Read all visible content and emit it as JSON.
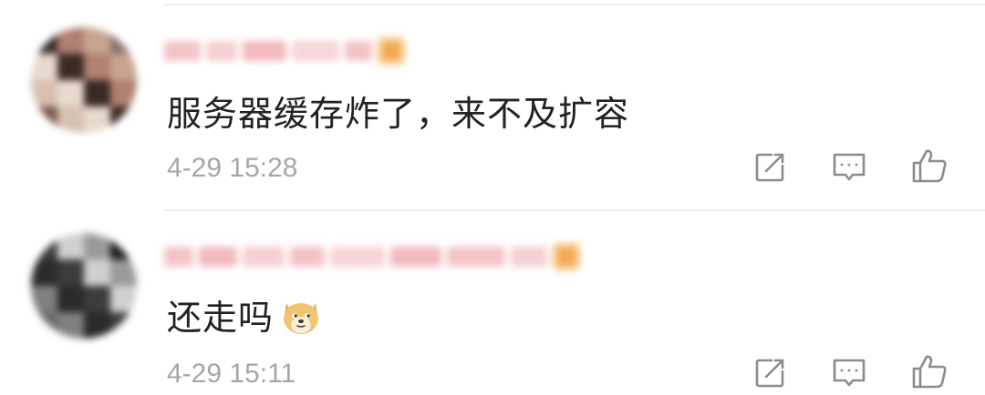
{
  "comments": [
    {
      "text": "服务器缓存炸了，来不及扩容",
      "timestamp": "4-29 15:28",
      "avatar_palette": [
        "#3a2a24",
        "#7a5a4a",
        "#c9a48f",
        "#e9d9cf",
        "#5a4038",
        "#b08070",
        "#d8c0b0",
        "#8a7070"
      ],
      "username_blurred": true,
      "badge_icon": "vip-badge-icon",
      "emoji": null
    },
    {
      "text": "还走吗",
      "timestamp": "4-29 15:11",
      "avatar_palette": [
        "#1c1c1c",
        "#3c3c3c",
        "#6a6a6a",
        "#9a9a9a",
        "#2a2a2a",
        "#505050",
        "#d0d0d0",
        "#808080"
      ],
      "username_blurred": true,
      "badge_icon": "vip-badge-icon",
      "emoji": "doge-emoji"
    }
  ],
  "actions": {
    "share_icon": "share-icon",
    "reply_icon": "comment-icon",
    "like_icon": "thumbs-up-icon"
  },
  "colors": {
    "text": "#222222",
    "meta": "#a6a6a6",
    "icon": "#8c8c8c",
    "divider": "#ececec",
    "badge": "#f3a650"
  }
}
